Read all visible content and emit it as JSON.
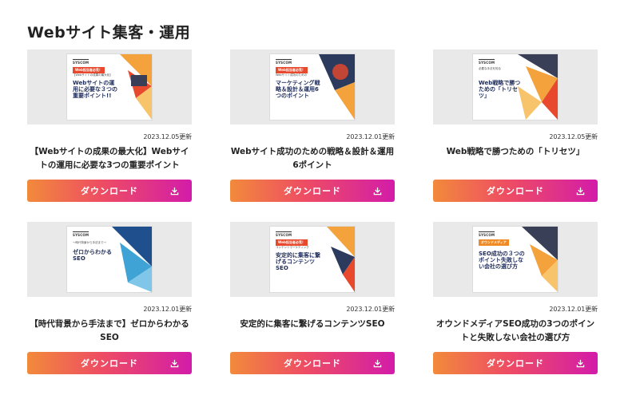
{
  "section": {
    "title": "Webサイト集客・運用"
  },
  "cards": [
    {
      "cover": {
        "logo": "SYSCOM",
        "tag": "Web担当者必見！",
        "sub": "【Webサイトの成果の最大化】",
        "headline": "Webサイトの運用に必要な３つの重要ポイント!!"
      },
      "date": "2023.12.05更新",
      "title": "【Webサイトの成果の最大化】Webサイトの運用に必要な3つの重要ポイント",
      "button": "ダウンロード"
    },
    {
      "cover": {
        "logo": "SYSCOM",
        "tag": "Web担当者必見！",
        "sub": "Webサイト成功のための",
        "headline": "マーケティング戦略＆設計＆運用6つのポイント"
      },
      "date": "2023.12.01更新",
      "title": "Webサイト成功のための戦略＆設計＆運用6ポイント",
      "button": "ダウンロード"
    },
    {
      "cover": {
        "logo": "SYSCOM",
        "tag": "",
        "sub": "必要な手法を知る",
        "headline": "Web戦略で勝つための「トリセツ」"
      },
      "date": "2023.12.05更新",
      "title": "Web戦略で勝つための「トリセツ」",
      "button": "ダウンロード"
    },
    {
      "cover": {
        "logo": "SYSCOM",
        "tag": "",
        "sub": "〜時代背景から手法まで〜",
        "headline": "ゼロからわかるSEO"
      },
      "date": "2023.12.01更新",
      "title": "【時代背景から手法まで】ゼロからわかるSEO",
      "button": "ダウンロード"
    },
    {
      "cover": {
        "logo": "SYSCOM",
        "tag": "Web担当者必見！",
        "sub": "コンテンツマーケティング",
        "headline": "安定的に集客に繋げるコンテンツSEO"
      },
      "date": "2023.12.01更新",
      "title": "安定的に集客に繋げるコンテンツSEO",
      "button": "ダウンロード"
    },
    {
      "cover": {
        "logo": "SYSCOM",
        "tag": "オウンドメディア",
        "sub": "",
        "headline": "SEO成功の３つのポイント失敗しない会社の選び方"
      },
      "date": "2023.12.01更新",
      "title": "オウンドメディアSEO成功の3つのポイントと失敗しない会社の選び方",
      "button": "ダウンロード"
    }
  ],
  "colors": {
    "button_gradient_start": "#f28a3b",
    "button_gradient_mid": "#ee4d63",
    "button_gradient_end": "#d31ca9",
    "thumb_bg": "#e9e9e9",
    "title_text": "#222222"
  },
  "icons": {
    "download": "download-icon"
  }
}
